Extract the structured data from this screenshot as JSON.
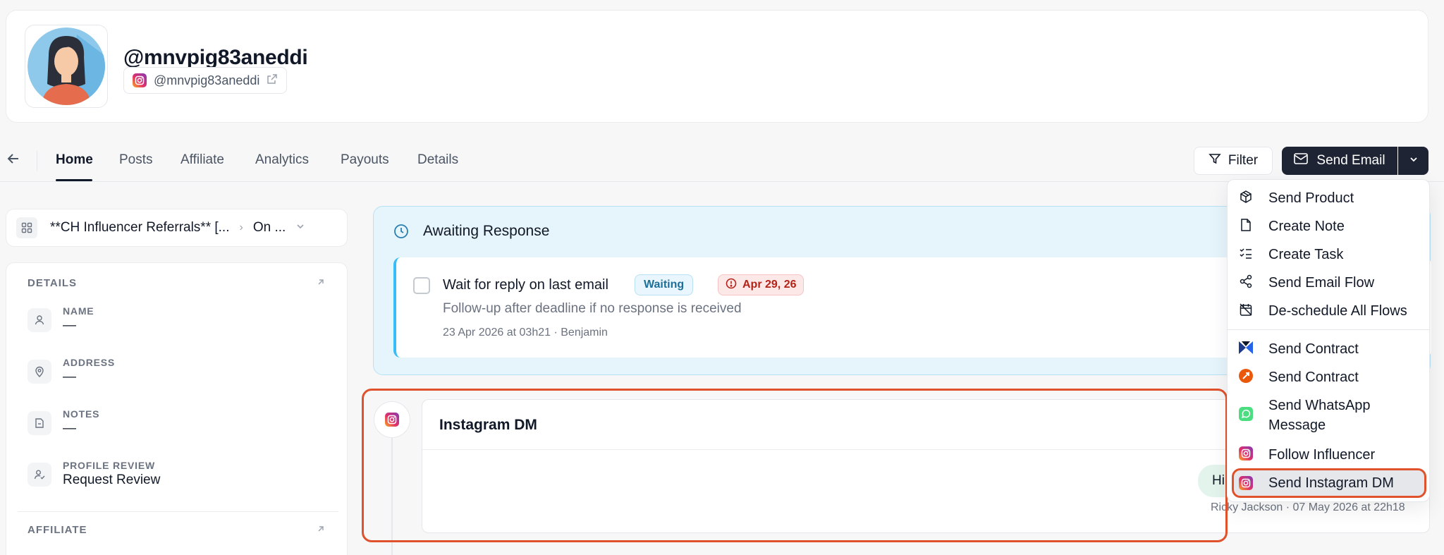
{
  "profile": {
    "handle": "@mnvpig83aneddi",
    "instagram_handle": "@mnvpig83aneddi"
  },
  "tabs": [
    "Home",
    "Posts",
    "Affiliate",
    "Analytics",
    "Payouts",
    "Details"
  ],
  "toolbar": {
    "filter_label": "Filter",
    "send_email_label": "Send Email"
  },
  "campaign": {
    "name": "**CH Influencer Referrals** [...",
    "stage": "On ..."
  },
  "details": {
    "section_label": "DETAILS",
    "fields": [
      {
        "label": "NAME",
        "value": "—",
        "icon": "user-icon"
      },
      {
        "label": "ADDRESS",
        "value": "—",
        "icon": "map-pin-icon"
      },
      {
        "label": "NOTES",
        "value": "—",
        "icon": "file-icon"
      },
      {
        "label": "PROFILE REVIEW",
        "value": "Request Review",
        "icon": "user-check-icon"
      }
    ],
    "affiliate_label": "AFFILIATE"
  },
  "awaiting": {
    "title": "Awaiting Response",
    "task": {
      "title": "Wait for reply on last email",
      "status": "Waiting",
      "due": "Apr 29, 26",
      "description": "Follow-up after deadline if no response is received",
      "meta": "23 Apr 2026 at 03h21 · Benjamin"
    }
  },
  "dm": {
    "title": "Instagram DM",
    "message": "Hi",
    "meta": "Ricky Jackson · 07 May 2026 at 22h18"
  },
  "menu": {
    "items": [
      {
        "label": "Send Product",
        "icon": "package-icon"
      },
      {
        "label": "Create Note",
        "icon": "note-icon"
      },
      {
        "label": "Create Task",
        "icon": "checklist-icon"
      },
      {
        "label": "Send Email Flow",
        "icon": "share-nodes-icon"
      },
      {
        "label": "De-schedule All Flows",
        "icon": "calendar-off-icon"
      },
      {
        "label": "Send Contract",
        "icon": "contract-x-icon"
      },
      {
        "label": "Send Contract",
        "icon": "contract-orange-icon"
      },
      {
        "label": "Send WhatsApp Message",
        "icon": "whatsapp-icon"
      },
      {
        "label": "Follow Influencer",
        "icon": "instagram-icon"
      },
      {
        "label": "Send Instagram DM",
        "icon": "instagram-icon"
      }
    ]
  },
  "colors": {
    "primary_button": "#1e2433",
    "highlight": "#e0522b",
    "awaiting_bg": "#e6f4fb",
    "waiting_badge": "#1d6f9a",
    "due_badge": "#b42318"
  }
}
